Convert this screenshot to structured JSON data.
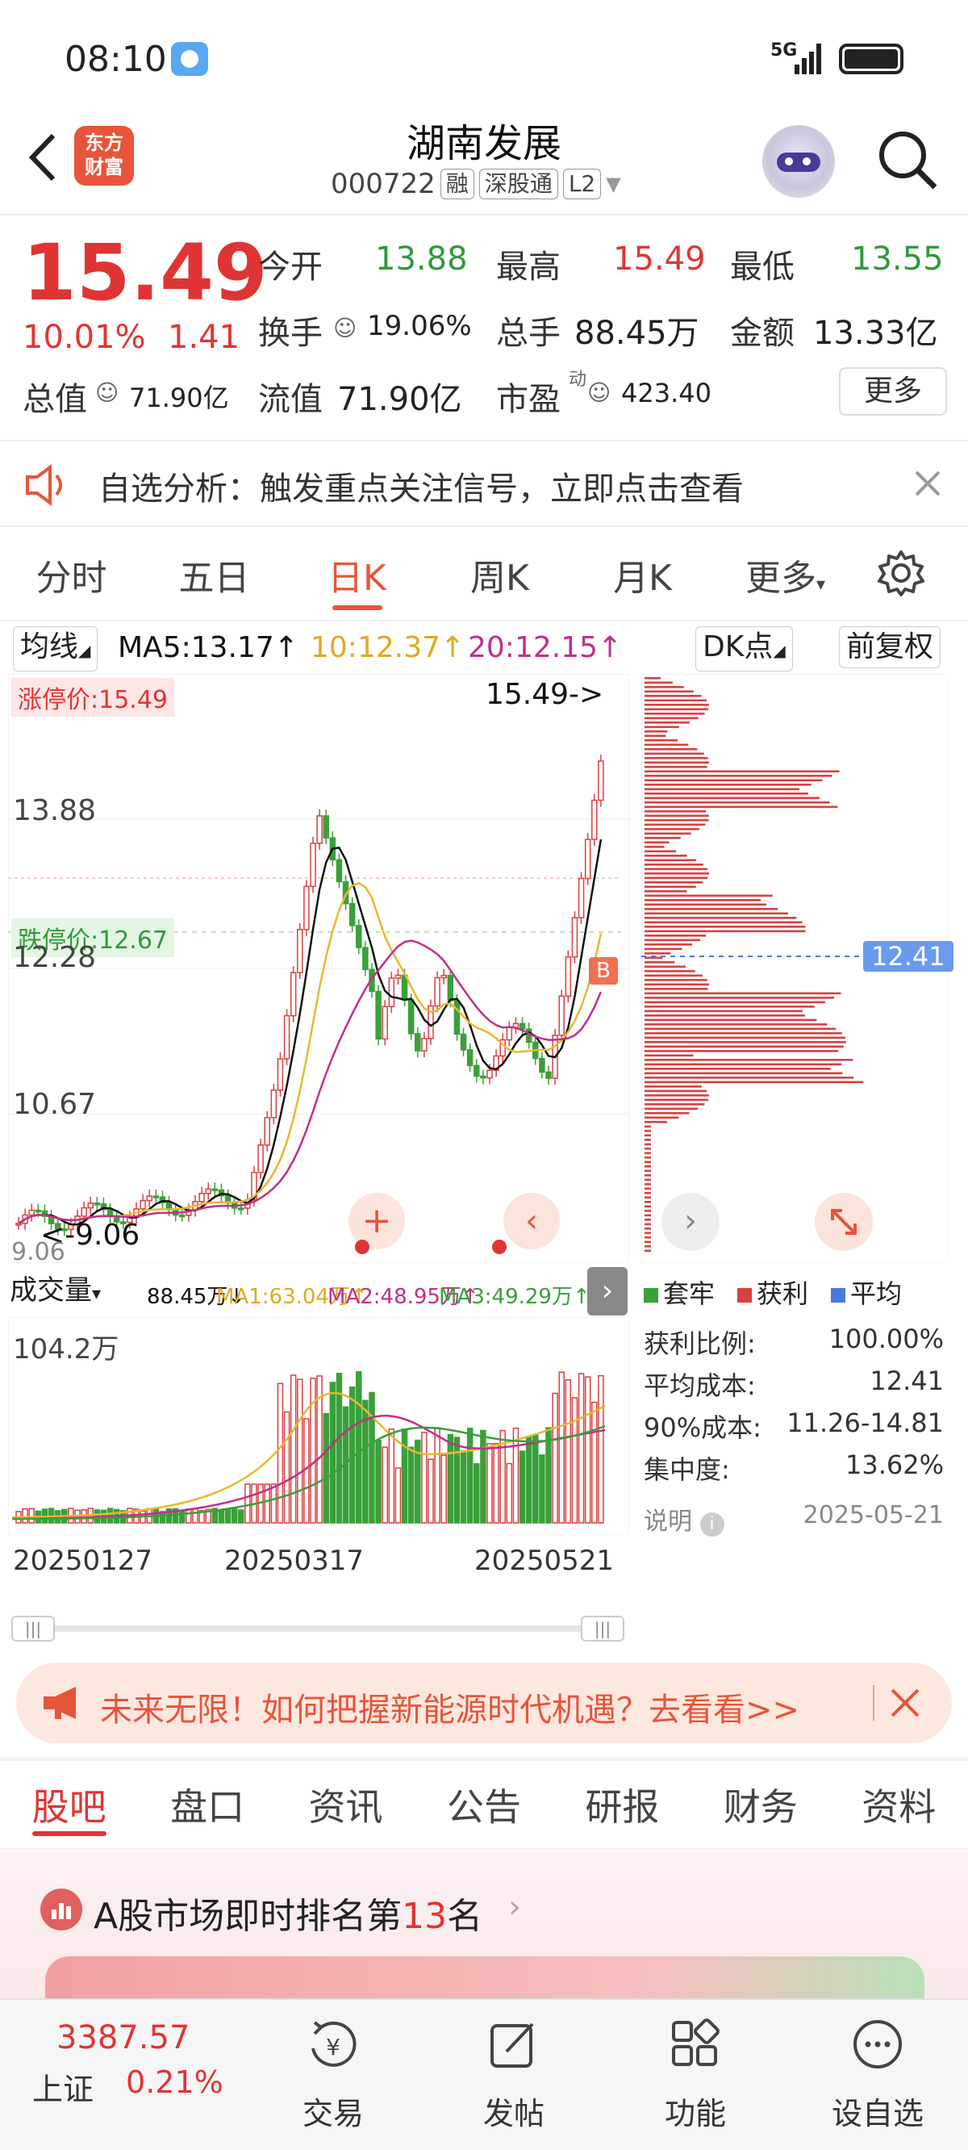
{
  "status": {
    "time": "08:10",
    "network": "5G"
  },
  "header": {
    "title": "湖南发展",
    "code": "000722",
    "tag_margin": "融",
    "tag_connect": "深股通",
    "tag_level": "L2",
    "brand_line1": "东方",
    "brand_line2": "财富"
  },
  "quote": {
    "price": "15.49",
    "change_pct": "10.01%",
    "change_amt": "1.41",
    "open_label": "今开",
    "open": "13.88",
    "high_label": "最高",
    "high": "15.49",
    "low_label": "最低",
    "low": "13.55",
    "turnover_label": "换手",
    "turnover": "19.06%",
    "volume_label": "总手",
    "volume": "88.45万",
    "amount_label": "金额",
    "amount": "13.33亿",
    "mktcap_label": "总值",
    "mktcap": "71.90亿",
    "float_label": "流值",
    "float": "71.90亿",
    "pe_label": "市盈",
    "pe_sup": "动",
    "pe": "423.40",
    "more": "更多"
  },
  "banner": {
    "text": "自选分析：触发重点关注信号，立即点击查看"
  },
  "tabs": [
    "分时",
    "五日",
    "日K",
    "周K",
    "月K",
    "更多"
  ],
  "chart": {
    "indicator": "均线",
    "ma5": "MA5:13.17↑",
    "ma10": "10:12.37↑",
    "ma20": "20:12.15↑",
    "dk": "DK点",
    "adjust": "前复权",
    "limit_up": "涨停价:15.49",
    "limit_down": "跌停价:12.67",
    "last_label": "15.49->",
    "price_ticks": [
      "13.88",
      "12.28",
      "10.67"
    ],
    "low_label": "<-9.06",
    "bottom_tick": "9.06",
    "b_marker": "B",
    "cost_label": "12.41",
    "vol_indicator": "成交量",
    "vol_values": "88.45万↓",
    "vol_ma1": "MA1:63.04万↑",
    "vol_ma2": "MA2:48.95万↑",
    "vol_ma3": "MA3:49.29万↑",
    "vol_max": "104.2万",
    "dates": [
      "20250127",
      "20250317",
      "20250521"
    ],
    "legend": [
      "套牢",
      "获利",
      "平均"
    ],
    "stats": [
      {
        "label": "获利比例:",
        "value": "100.00%"
      },
      {
        "label": "平均成本:",
        "value": "12.41"
      },
      {
        "label": "90%成本:",
        "value": "11.26-14.81"
      },
      {
        "label": "集中度:",
        "value": "13.62%"
      }
    ],
    "note_label": "说明",
    "note_date": "2025-05-21",
    "colors": {
      "up": "#d94040",
      "down": "#3aa03a",
      "ma5": "#111111",
      "ma10": "#e8b830",
      "ma20": "#c0308a"
    }
  },
  "ad": {
    "text": "未来无限！如何把握新能源时代机遇？去看看>>"
  },
  "bottom_tabs": [
    "股吧",
    "盘口",
    "资讯",
    "公告",
    "研报",
    "财务",
    "资料"
  ],
  "ranking": {
    "prefix": "A股市场即时排名第",
    "rank": "13",
    "suffix": "名"
  },
  "nav": {
    "index_value": "3387.57",
    "index_name": "上证",
    "index_pct": "0.21%",
    "items": [
      "交易",
      "发帖",
      "功能",
      "设自选"
    ]
  }
}
